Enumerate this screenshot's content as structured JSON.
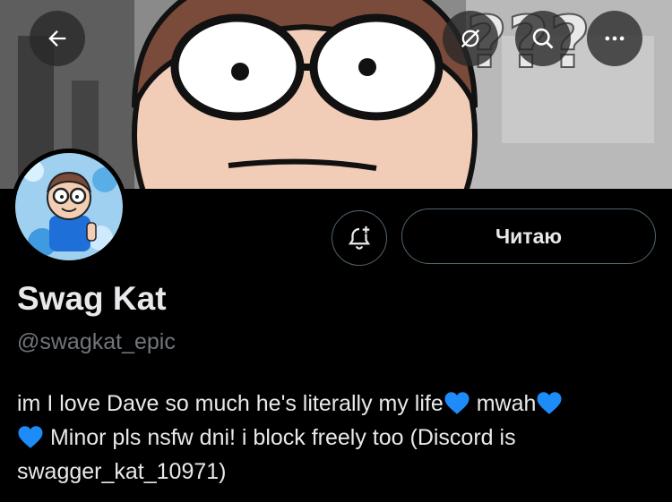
{
  "header": {
    "back_icon": "arrow-left-icon",
    "translate_icon": "no-eye-icon",
    "search_icon": "search-icon",
    "more_icon": "more-dots-icon"
  },
  "banner": {
    "overlay_text": "???"
  },
  "profile": {
    "display_name": "Swag Kat",
    "handle": "@swagkat_epic",
    "follow_label": "Читаю",
    "bell_icon": "notification-bell-plus-icon",
    "bio_line_1_part1": "im I love Dave so much he's literally my life",
    "bio_line_1_part2": "mwah",
    "bio_line_2": "Minor pls nsfw dni! i block freely too (Discord is",
    "bio_line_3": "swagger_kat_10971)",
    "emoji": "blue-heart-icon"
  },
  "colors": {
    "background": "#000000",
    "text": "#e7e9ea",
    "secondary_text": "#71767b",
    "border": "#536471",
    "heart": "#1d8cf8"
  }
}
